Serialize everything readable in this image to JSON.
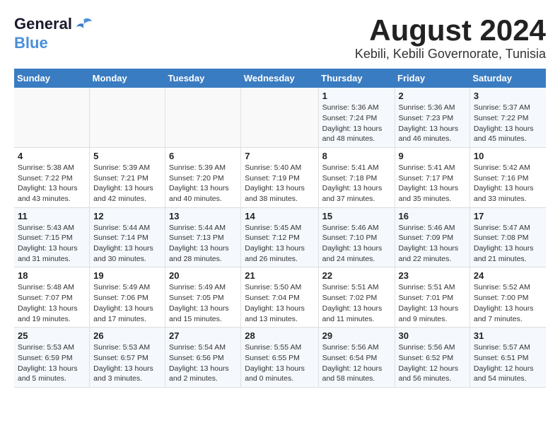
{
  "logo": {
    "line1": "General",
    "line2": "Blue"
  },
  "title": "August 2024",
  "subtitle": "Kebili, Kebili Governorate, Tunisia",
  "days_of_week": [
    "Sunday",
    "Monday",
    "Tuesday",
    "Wednesday",
    "Thursday",
    "Friday",
    "Saturday"
  ],
  "weeks": [
    [
      {
        "day": "",
        "info": ""
      },
      {
        "day": "",
        "info": ""
      },
      {
        "day": "",
        "info": ""
      },
      {
        "day": "",
        "info": ""
      },
      {
        "day": "1",
        "info": "Sunrise: 5:36 AM\nSunset: 7:24 PM\nDaylight: 13 hours\nand 48 minutes."
      },
      {
        "day": "2",
        "info": "Sunrise: 5:36 AM\nSunset: 7:23 PM\nDaylight: 13 hours\nand 46 minutes."
      },
      {
        "day": "3",
        "info": "Sunrise: 5:37 AM\nSunset: 7:22 PM\nDaylight: 13 hours\nand 45 minutes."
      }
    ],
    [
      {
        "day": "4",
        "info": "Sunrise: 5:38 AM\nSunset: 7:22 PM\nDaylight: 13 hours\nand 43 minutes."
      },
      {
        "day": "5",
        "info": "Sunrise: 5:39 AM\nSunset: 7:21 PM\nDaylight: 13 hours\nand 42 minutes."
      },
      {
        "day": "6",
        "info": "Sunrise: 5:39 AM\nSunset: 7:20 PM\nDaylight: 13 hours\nand 40 minutes."
      },
      {
        "day": "7",
        "info": "Sunrise: 5:40 AM\nSunset: 7:19 PM\nDaylight: 13 hours\nand 38 minutes."
      },
      {
        "day": "8",
        "info": "Sunrise: 5:41 AM\nSunset: 7:18 PM\nDaylight: 13 hours\nand 37 minutes."
      },
      {
        "day": "9",
        "info": "Sunrise: 5:41 AM\nSunset: 7:17 PM\nDaylight: 13 hours\nand 35 minutes."
      },
      {
        "day": "10",
        "info": "Sunrise: 5:42 AM\nSunset: 7:16 PM\nDaylight: 13 hours\nand 33 minutes."
      }
    ],
    [
      {
        "day": "11",
        "info": "Sunrise: 5:43 AM\nSunset: 7:15 PM\nDaylight: 13 hours\nand 31 minutes."
      },
      {
        "day": "12",
        "info": "Sunrise: 5:44 AM\nSunset: 7:14 PM\nDaylight: 13 hours\nand 30 minutes."
      },
      {
        "day": "13",
        "info": "Sunrise: 5:44 AM\nSunset: 7:13 PM\nDaylight: 13 hours\nand 28 minutes."
      },
      {
        "day": "14",
        "info": "Sunrise: 5:45 AM\nSunset: 7:12 PM\nDaylight: 13 hours\nand 26 minutes."
      },
      {
        "day": "15",
        "info": "Sunrise: 5:46 AM\nSunset: 7:10 PM\nDaylight: 13 hours\nand 24 minutes."
      },
      {
        "day": "16",
        "info": "Sunrise: 5:46 AM\nSunset: 7:09 PM\nDaylight: 13 hours\nand 22 minutes."
      },
      {
        "day": "17",
        "info": "Sunrise: 5:47 AM\nSunset: 7:08 PM\nDaylight: 13 hours\nand 21 minutes."
      }
    ],
    [
      {
        "day": "18",
        "info": "Sunrise: 5:48 AM\nSunset: 7:07 PM\nDaylight: 13 hours\nand 19 minutes."
      },
      {
        "day": "19",
        "info": "Sunrise: 5:49 AM\nSunset: 7:06 PM\nDaylight: 13 hours\nand 17 minutes."
      },
      {
        "day": "20",
        "info": "Sunrise: 5:49 AM\nSunset: 7:05 PM\nDaylight: 13 hours\nand 15 minutes."
      },
      {
        "day": "21",
        "info": "Sunrise: 5:50 AM\nSunset: 7:04 PM\nDaylight: 13 hours\nand 13 minutes."
      },
      {
        "day": "22",
        "info": "Sunrise: 5:51 AM\nSunset: 7:02 PM\nDaylight: 13 hours\nand 11 minutes."
      },
      {
        "day": "23",
        "info": "Sunrise: 5:51 AM\nSunset: 7:01 PM\nDaylight: 13 hours\nand 9 minutes."
      },
      {
        "day": "24",
        "info": "Sunrise: 5:52 AM\nSunset: 7:00 PM\nDaylight: 13 hours\nand 7 minutes."
      }
    ],
    [
      {
        "day": "25",
        "info": "Sunrise: 5:53 AM\nSunset: 6:59 PM\nDaylight: 13 hours\nand 5 minutes."
      },
      {
        "day": "26",
        "info": "Sunrise: 5:53 AM\nSunset: 6:57 PM\nDaylight: 13 hours\nand 3 minutes."
      },
      {
        "day": "27",
        "info": "Sunrise: 5:54 AM\nSunset: 6:56 PM\nDaylight: 13 hours\nand 2 minutes."
      },
      {
        "day": "28",
        "info": "Sunrise: 5:55 AM\nSunset: 6:55 PM\nDaylight: 13 hours\nand 0 minutes."
      },
      {
        "day": "29",
        "info": "Sunrise: 5:56 AM\nSunset: 6:54 PM\nDaylight: 12 hours\nand 58 minutes."
      },
      {
        "day": "30",
        "info": "Sunrise: 5:56 AM\nSunset: 6:52 PM\nDaylight: 12 hours\nand 56 minutes."
      },
      {
        "day": "31",
        "info": "Sunrise: 5:57 AM\nSunset: 6:51 PM\nDaylight: 12 hours\nand 54 minutes."
      }
    ]
  ]
}
